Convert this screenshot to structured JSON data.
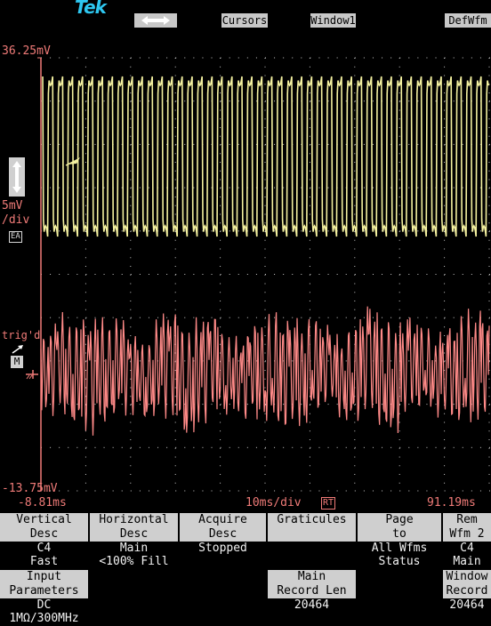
{
  "topbar": {
    "brand": "Tek",
    "cursors": "Cursors",
    "window": "Window1",
    "defwfm": "DefWfm"
  },
  "screen": {
    "top_level": "36.25mV",
    "bottom_level": "-13.75mV",
    "left_time": "-8.81ms",
    "right_time": "91.19ms",
    "timebase": "10ms/div",
    "rt_badge": "RT",
    "scale_top": "5mV",
    "scale_bottom": "/div",
    "ea_badge": "EA",
    "trig_label": "trig'd",
    "m_badge": "M",
    "colors": {
      "trace1": "#f4f1a0",
      "trace2": "#ff8a88",
      "grid": "#c8c8c8",
      "text": "#f07b78"
    }
  },
  "menu": {
    "row1": [
      {
        "title": [
          "Vertical",
          "Desc"
        ],
        "value": [
          "C4",
          "Fast"
        ]
      },
      {
        "title": [
          "Horizontal",
          "Desc"
        ],
        "value": [
          "Main",
          "<100% Fill"
        ]
      },
      {
        "title": [
          "Acquire",
          "Desc"
        ],
        "value": [
          "Stopped",
          ""
        ]
      },
      {
        "title": [
          "Graticules",
          ""
        ],
        "value": [
          "",
          ""
        ]
      },
      {
        "title": [
          "Page",
          "to"
        ],
        "value": [
          "All Wfms",
          "Status"
        ]
      },
      {
        "title": [
          "Rem",
          "Wfm 2"
        ],
        "value": [
          "C4",
          "Main"
        ]
      }
    ],
    "row2": [
      {
        "title": [
          "Input",
          "Parameters"
        ],
        "value": [
          "DC",
          "1MΩ/300MHz"
        ]
      },
      {
        "title": [
          "",
          ""
        ],
        "value": [
          "",
          ""
        ]
      },
      {
        "title": [
          "",
          ""
        ],
        "value": [
          "",
          ""
        ]
      },
      {
        "title": [
          "Main",
          "Record Len"
        ],
        "value": [
          "20464",
          ""
        ]
      },
      {
        "title": [
          "",
          ""
        ],
        "value": [
          "",
          ""
        ]
      },
      {
        "title": [
          "Window",
          "Record Len"
        ],
        "value": [
          "20464",
          ""
        ]
      }
    ]
  }
}
